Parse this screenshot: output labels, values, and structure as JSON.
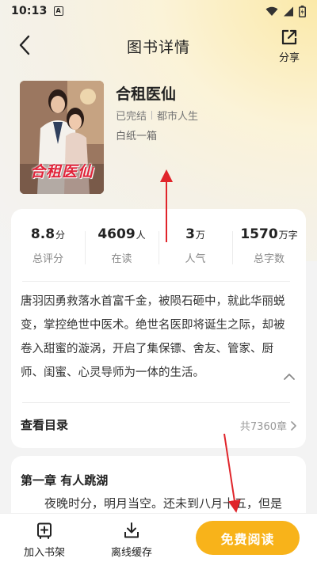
{
  "status_bar": {
    "time": "10:13",
    "sim_badge": "A"
  },
  "nav": {
    "title": "图书详情",
    "share_label": "分享"
  },
  "book": {
    "cover_title": "合租医仙",
    "title": "合租医仙",
    "status": "已完结",
    "category": "都市人生",
    "author": "白纸一箱"
  },
  "stats": [
    {
      "value": "8.8",
      "unit": "分",
      "label": "总评分"
    },
    {
      "value": "4609",
      "unit": "人",
      "label": "在读"
    },
    {
      "value": "3",
      "unit": "万",
      "label": "人气"
    },
    {
      "value": "1570",
      "unit": "万字",
      "label": "总字数"
    }
  ],
  "synopsis": "唐羽因勇救落水首富千金，被陨石砸中，就此华丽蜕变，掌控绝世中医术。绝世名医即将诞生之际，却被卷入甜蜜的漩涡，开启了集保镖、舍友、管家、厨师、闺蜜、心灵导师为一体的生活。",
  "toc": {
    "label": "查看目录",
    "count": "共7360章"
  },
  "chapter": {
    "title": "第一章 有人跳湖",
    "preview": "夜晚时分，明月当空。还未到八月十五，但是"
  },
  "bottom_bar": {
    "add_shelf": "加入书架",
    "offline_cache": "离线缓存",
    "free_read": "免费阅读"
  },
  "colors": {
    "accent": "#F8B31A",
    "annotation_arrow": "#E0242A"
  }
}
